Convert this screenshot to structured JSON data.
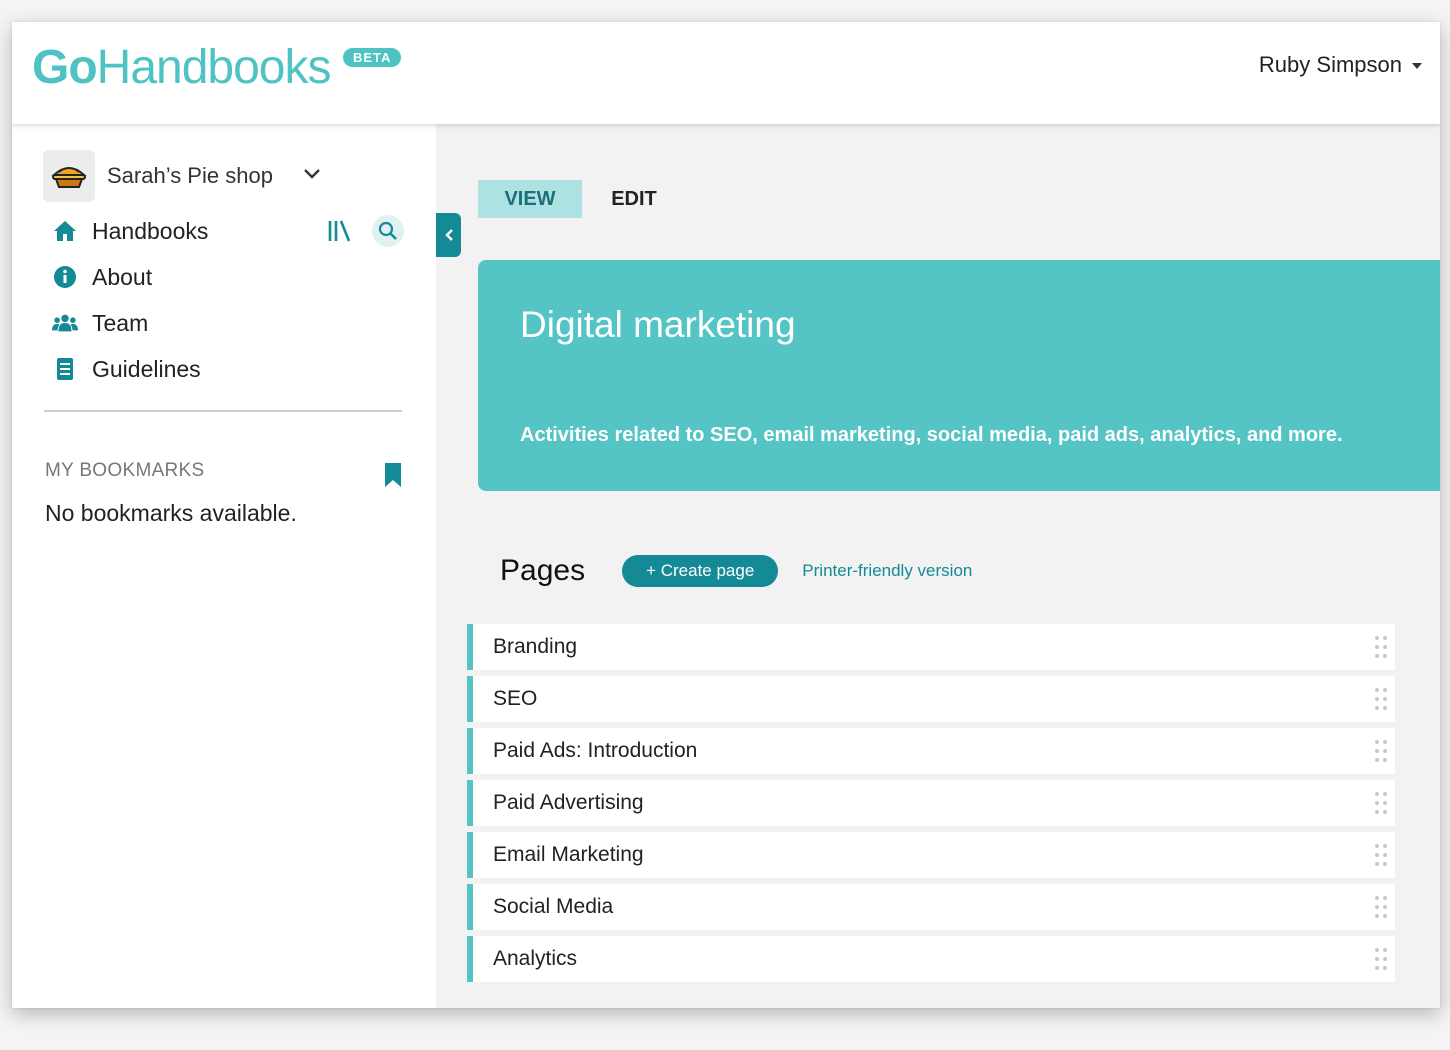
{
  "header": {
    "logo_go": "Go",
    "logo_handbooks": "Handbooks",
    "beta_label": "BETA",
    "user_name": "Ruby Simpson"
  },
  "sidebar": {
    "workspace_name": "Sarah’s Pie shop",
    "workspace_icon": "pie-icon",
    "nav": [
      {
        "label": "Handbooks",
        "icon": "home-icon"
      },
      {
        "label": "About",
        "icon": "info-icon"
      },
      {
        "label": "Team",
        "icon": "team-icon"
      },
      {
        "label": "Guidelines",
        "icon": "document-icon"
      }
    ],
    "tools": [
      "library-icon",
      "search-icon"
    ],
    "bookmarks_title": "MY BOOKMARKS",
    "bookmarks_empty": "No bookmarks available."
  },
  "main": {
    "tabs": [
      {
        "label": "VIEW",
        "active": true
      },
      {
        "label": "EDIT",
        "active": false
      }
    ],
    "hero": {
      "title": "Digital marketing",
      "description": "Activities related to SEO, email marketing, social media, paid ads, analytics, and more."
    },
    "pages_title": "Pages",
    "create_page_label": "+ Create page",
    "printer_link": "Printer-friendly version",
    "pages": [
      "Branding",
      "SEO",
      "Paid Ads: Introduction",
      "Paid Advertising",
      "Email Marketing",
      "Social Media",
      "Analytics"
    ]
  },
  "colors": {
    "brand": "#4fc3c3",
    "accent_dark": "#148a96",
    "hero_bg": "#55c4c4",
    "tab_active_bg": "#aee1e1"
  }
}
